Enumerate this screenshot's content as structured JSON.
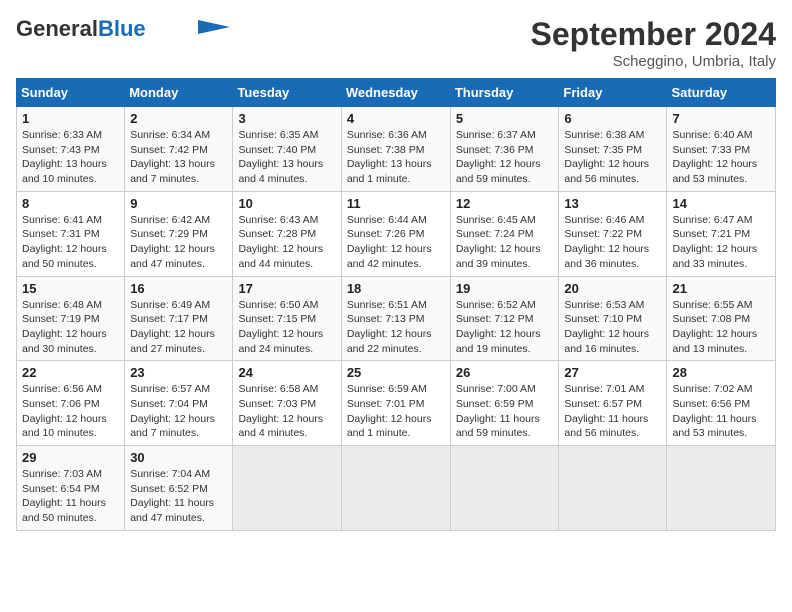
{
  "header": {
    "logo_line1": "General",
    "logo_line2": "Blue",
    "month": "September 2024",
    "location": "Scheggino, Umbria, Italy"
  },
  "weekdays": [
    "Sunday",
    "Monday",
    "Tuesday",
    "Wednesday",
    "Thursday",
    "Friday",
    "Saturday"
  ],
  "weeks": [
    [
      {
        "day": "1",
        "info": "Sunrise: 6:33 AM\nSunset: 7:43 PM\nDaylight: 13 hours\nand 10 minutes."
      },
      {
        "day": "2",
        "info": "Sunrise: 6:34 AM\nSunset: 7:42 PM\nDaylight: 13 hours\nand 7 minutes."
      },
      {
        "day": "3",
        "info": "Sunrise: 6:35 AM\nSunset: 7:40 PM\nDaylight: 13 hours\nand 4 minutes."
      },
      {
        "day": "4",
        "info": "Sunrise: 6:36 AM\nSunset: 7:38 PM\nDaylight: 13 hours\nand 1 minute."
      },
      {
        "day": "5",
        "info": "Sunrise: 6:37 AM\nSunset: 7:36 PM\nDaylight: 12 hours\nand 59 minutes."
      },
      {
        "day": "6",
        "info": "Sunrise: 6:38 AM\nSunset: 7:35 PM\nDaylight: 12 hours\nand 56 minutes."
      },
      {
        "day": "7",
        "info": "Sunrise: 6:40 AM\nSunset: 7:33 PM\nDaylight: 12 hours\nand 53 minutes."
      }
    ],
    [
      {
        "day": "8",
        "info": "Sunrise: 6:41 AM\nSunset: 7:31 PM\nDaylight: 12 hours\nand 50 minutes."
      },
      {
        "day": "9",
        "info": "Sunrise: 6:42 AM\nSunset: 7:29 PM\nDaylight: 12 hours\nand 47 minutes."
      },
      {
        "day": "10",
        "info": "Sunrise: 6:43 AM\nSunset: 7:28 PM\nDaylight: 12 hours\nand 44 minutes."
      },
      {
        "day": "11",
        "info": "Sunrise: 6:44 AM\nSunset: 7:26 PM\nDaylight: 12 hours\nand 42 minutes."
      },
      {
        "day": "12",
        "info": "Sunrise: 6:45 AM\nSunset: 7:24 PM\nDaylight: 12 hours\nand 39 minutes."
      },
      {
        "day": "13",
        "info": "Sunrise: 6:46 AM\nSunset: 7:22 PM\nDaylight: 12 hours\nand 36 minutes."
      },
      {
        "day": "14",
        "info": "Sunrise: 6:47 AM\nSunset: 7:21 PM\nDaylight: 12 hours\nand 33 minutes."
      }
    ],
    [
      {
        "day": "15",
        "info": "Sunrise: 6:48 AM\nSunset: 7:19 PM\nDaylight: 12 hours\nand 30 minutes."
      },
      {
        "day": "16",
        "info": "Sunrise: 6:49 AM\nSunset: 7:17 PM\nDaylight: 12 hours\nand 27 minutes."
      },
      {
        "day": "17",
        "info": "Sunrise: 6:50 AM\nSunset: 7:15 PM\nDaylight: 12 hours\nand 24 minutes."
      },
      {
        "day": "18",
        "info": "Sunrise: 6:51 AM\nSunset: 7:13 PM\nDaylight: 12 hours\nand 22 minutes."
      },
      {
        "day": "19",
        "info": "Sunrise: 6:52 AM\nSunset: 7:12 PM\nDaylight: 12 hours\nand 19 minutes."
      },
      {
        "day": "20",
        "info": "Sunrise: 6:53 AM\nSunset: 7:10 PM\nDaylight: 12 hours\nand 16 minutes."
      },
      {
        "day": "21",
        "info": "Sunrise: 6:55 AM\nSunset: 7:08 PM\nDaylight: 12 hours\nand 13 minutes."
      }
    ],
    [
      {
        "day": "22",
        "info": "Sunrise: 6:56 AM\nSunset: 7:06 PM\nDaylight: 12 hours\nand 10 minutes."
      },
      {
        "day": "23",
        "info": "Sunrise: 6:57 AM\nSunset: 7:04 PM\nDaylight: 12 hours\nand 7 minutes."
      },
      {
        "day": "24",
        "info": "Sunrise: 6:58 AM\nSunset: 7:03 PM\nDaylight: 12 hours\nand 4 minutes."
      },
      {
        "day": "25",
        "info": "Sunrise: 6:59 AM\nSunset: 7:01 PM\nDaylight: 12 hours\nand 1 minute."
      },
      {
        "day": "26",
        "info": "Sunrise: 7:00 AM\nSunset: 6:59 PM\nDaylight: 11 hours\nand 59 minutes."
      },
      {
        "day": "27",
        "info": "Sunrise: 7:01 AM\nSunset: 6:57 PM\nDaylight: 11 hours\nand 56 minutes."
      },
      {
        "day": "28",
        "info": "Sunrise: 7:02 AM\nSunset: 6:56 PM\nDaylight: 11 hours\nand 53 minutes."
      }
    ],
    [
      {
        "day": "29",
        "info": "Sunrise: 7:03 AM\nSunset: 6:54 PM\nDaylight: 11 hours\nand 50 minutes."
      },
      {
        "day": "30",
        "info": "Sunrise: 7:04 AM\nSunset: 6:52 PM\nDaylight: 11 hours\nand 47 minutes."
      },
      {
        "day": "",
        "info": ""
      },
      {
        "day": "",
        "info": ""
      },
      {
        "day": "",
        "info": ""
      },
      {
        "day": "",
        "info": ""
      },
      {
        "day": "",
        "info": ""
      }
    ]
  ]
}
